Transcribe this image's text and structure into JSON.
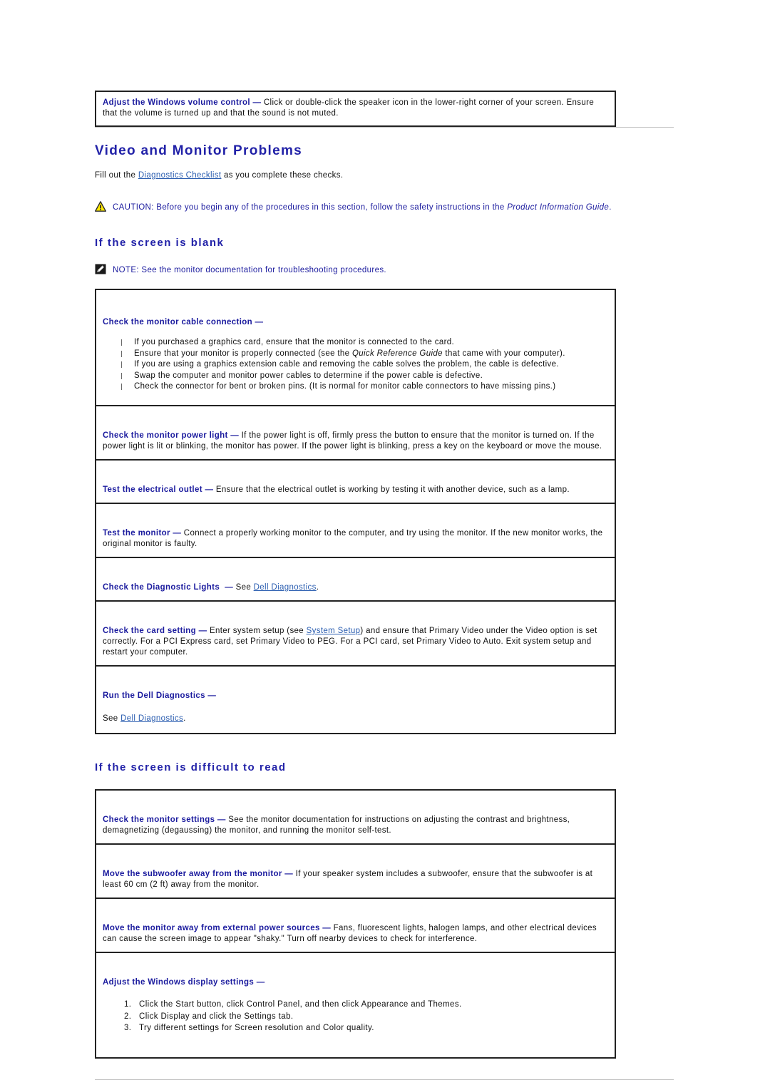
{
  "top_callout": {
    "lead": "Adjust the Windows volume control",
    "dash": "—",
    "text": " Click or double-click the speaker icon in the lower-right corner of your screen. Ensure that the volume is turned up and that the sound is not muted."
  },
  "section": {
    "title": "Video and Monitor Problems",
    "intro_before": "Fill out the ",
    "intro_link": "Diagnostics Checklist",
    "intro_after": " as you complete these checks.",
    "caution": {
      "label": "CAUTION:",
      "text": " Before you begin any of the procedures in this section, follow the safety instructions in the ",
      "italic": "Product Information Guide",
      "tail": "."
    }
  },
  "subsection_blank": {
    "title": "If the screen is blank",
    "note": {
      "label": "NOTE:",
      "text": " See the monitor documentation for troubleshooting procedures."
    },
    "rows": [
      {
        "lead": "Check the monitor cable connection",
        "dash": "—",
        "text": "",
        "bullets": [
          "If you purchased a graphics card, ensure that the monitor is connected to the card.",
          "Ensure that your monitor is properly connected (see the Quick Reference Guide that came with your computer).",
          "If you are using a graphics extension cable and removing the cable solves the problem, the cable is defective.",
          "Swap the computer and monitor power cables to determine if the power cable is defective.",
          "Check the connector for bent or broken pins. (It is normal for monitor cable connectors to have missing pins.)"
        ]
      },
      {
        "lead": "Check the monitor power light",
        "dash": "—",
        "text": " If the power light is off, firmly press the button to ensure that the monitor is turned on. If the power light is lit or blinking, the monitor has power. If the power light is blinking, press a key on the keyboard or move the mouse."
      },
      {
        "lead": "Test the electrical outlet",
        "dash": "—",
        "text": " Ensure that the electrical outlet is working by testing it with another device, such as a lamp."
      },
      {
        "lead": "Test the monitor",
        "dash": "—",
        "text": " Connect a properly working monitor to the computer, and try using the monitor. If the new monitor works, the original monitor is faulty."
      },
      {
        "lead": "Check the Diagnostic Lights",
        "dash": "—",
        "text": " See ",
        "link": "Dell Diagnostics",
        "tail": "."
      },
      {
        "lead": "Check the card setting",
        "dash": "—",
        "text": " Enter system setup (see ",
        "link": "System Setup",
        "tail": ") and ensure that Primary Video under the Video option is set correctly. For a PCI Express card, set Primary Video to PEG. For a PCI card, set Primary Video to Auto. Exit system setup and restart your computer."
      },
      {
        "lead": "Run the Dell Diagnostics",
        "dash": "—",
        "see_prefix": "See ",
        "link": "Dell Diagnostics",
        "tail": "."
      }
    ]
  },
  "subsection_difficult": {
    "title": "If the screen is difficult to read",
    "rows": [
      {
        "lead": "Check the monitor settings",
        "dash": "—",
        "text": " See the monitor documentation for instructions on adjusting the contrast and brightness, demagnetizing (degaussing) the monitor, and running the monitor self-test."
      },
      {
        "lead": "Move the subwoofer away from the monitor",
        "dash": "—",
        "text": " If your speaker system includes a subwoofer, ensure that the subwoofer is at least 60 cm (2 ft) away from the monitor."
      },
      {
        "lead": "Move the monitor away from external power sources",
        "dash": "—",
        "text": " Fans, fluorescent lights, halogen lamps, and other electrical devices can cause the screen image to appear \"shaky.\" Turn off nearby devices to check for interference."
      },
      {
        "lead": "Adjust the Windows display settings",
        "dash": "—",
        "steps": [
          "Click the Start button, click Control Panel, and then click Appearance and Themes.",
          "Click Display and click the Settings tab.",
          "Try different settings for Screen resolution and Color quality."
        ]
      }
    ]
  },
  "colors": {
    "heading_blue": "#2222a8",
    "lead_blue": "#1b1b9e",
    "link_blue": "#2a5db0",
    "border": "#222222",
    "rule": "#bfbfbf",
    "caution_yellow": "#ffe800"
  },
  "icons": {
    "caution": "warning-triangle-icon",
    "note": "pencil-note-icon"
  }
}
